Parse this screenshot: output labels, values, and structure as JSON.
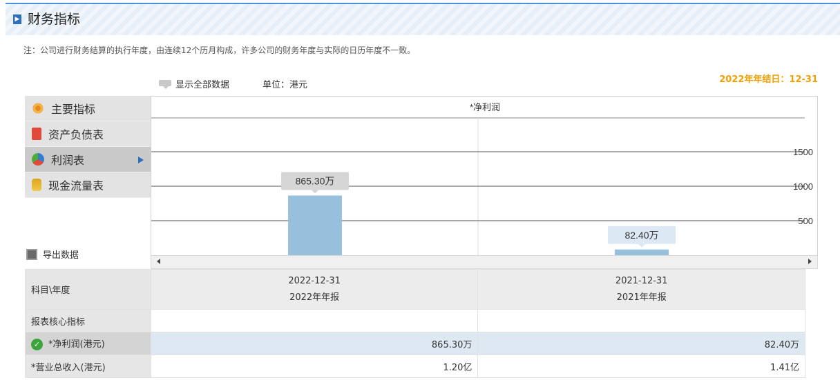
{
  "header": {
    "title": "财务指标",
    "icon": "square-arrow-icon"
  },
  "note": "注：公司进行财务结算的执行年度，由连续12个历月构成，许多公司的财务年度与实际的日历年度不一致。",
  "year_end": "2022年年结日：12-31",
  "toolbar": {
    "show_all": "显示全部数据",
    "unit": "单位：港元"
  },
  "sidebar": {
    "items": [
      {
        "label": "主要指标",
        "icon": "flower-icon"
      },
      {
        "label": "资产负债表",
        "icon": "document-icon"
      },
      {
        "label": "利润表",
        "icon": "pie-chart-icon",
        "active": true
      },
      {
        "label": "现金流量表",
        "icon": "coins-icon"
      }
    ],
    "export_label": "导出数据"
  },
  "chart_data": {
    "type": "bar",
    "title": "*净利润",
    "categories": [
      "2022-12-31",
      "2021-12-31"
    ],
    "values": [
      865.3,
      82.4
    ],
    "data_labels": [
      "865.30万",
      "82.40万"
    ],
    "y_ticks": [
      500,
      1000,
      1500
    ],
    "ylim": [
      0,
      1500
    ],
    "grid": true,
    "bar_color": "#97c0dd"
  },
  "table": {
    "corner": "科目\\年度",
    "columns": [
      {
        "date": "2022-12-31",
        "report": "2022年年报"
      },
      {
        "date": "2021-12-31",
        "report": "2021年年报"
      }
    ],
    "section": "报表核心指标",
    "rows": [
      {
        "label": "*净利润(港元)",
        "values": [
          "865.30万",
          "82.40万"
        ],
        "selected": true
      },
      {
        "label": "*营业总收入(港元)",
        "values": [
          "1.20亿",
          "1.41亿"
        ]
      }
    ]
  }
}
